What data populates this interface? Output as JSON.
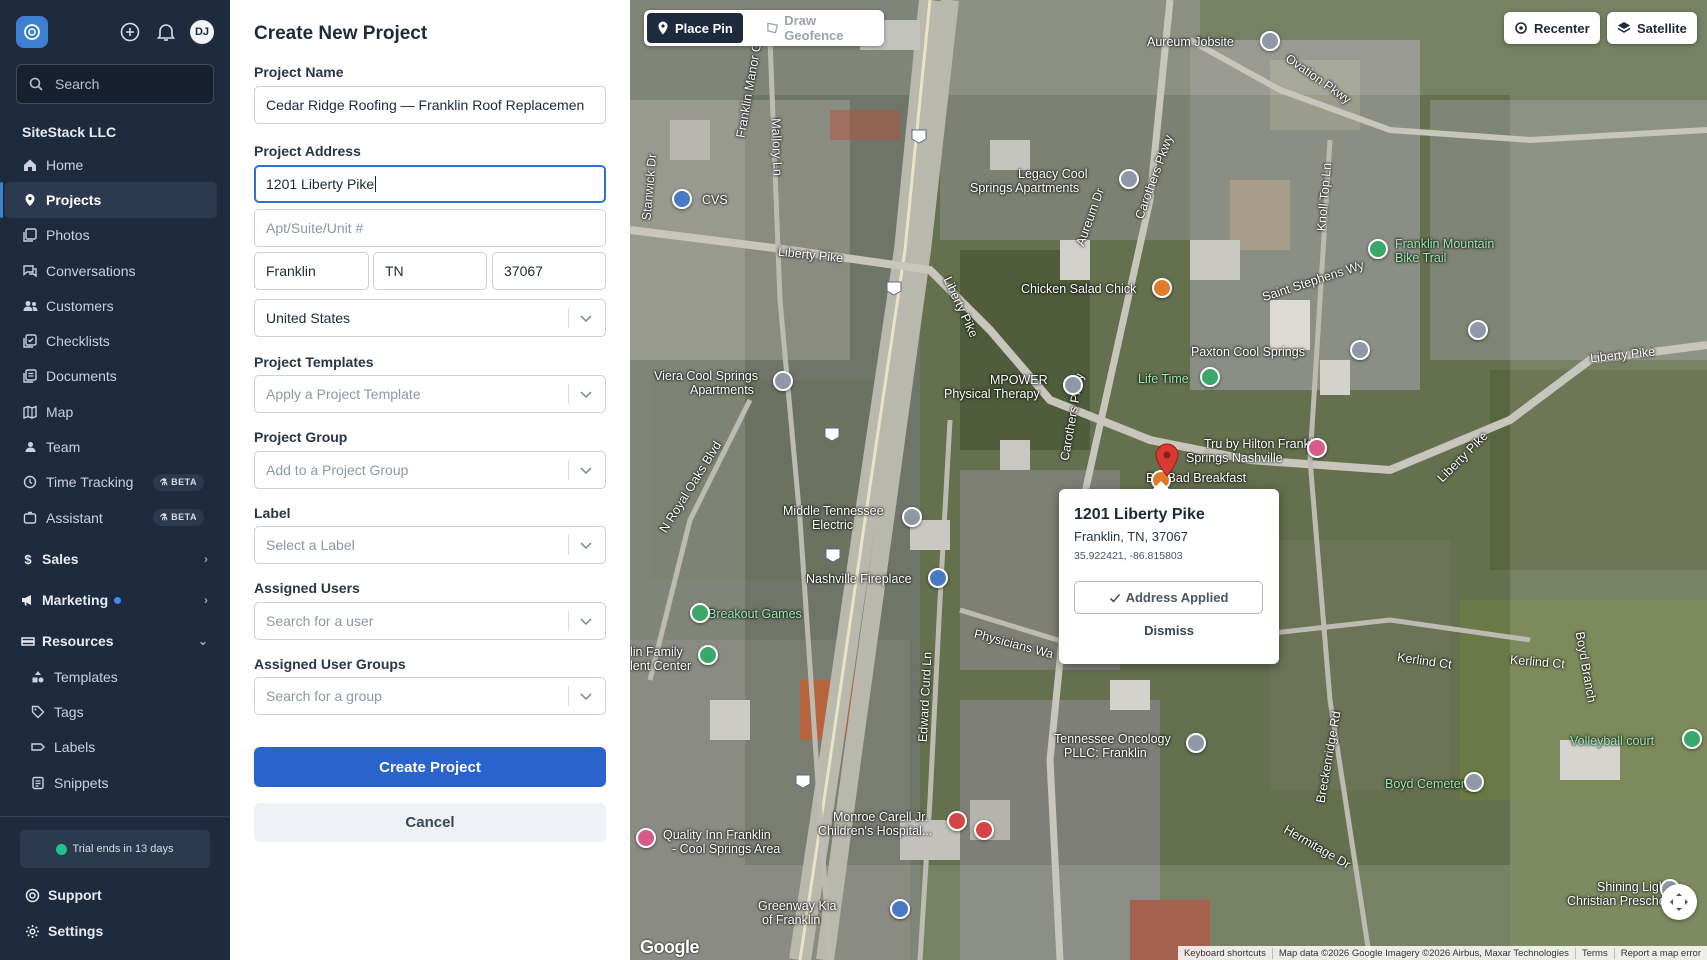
{
  "sidebar": {
    "avatar_initials": "DJ",
    "search_placeholder": "Search",
    "org_name": "SiteStack LLC",
    "nav": [
      {
        "label": "Home",
        "icon": "home-icon"
      },
      {
        "label": "Projects",
        "icon": "map-pin-icon",
        "active": true
      },
      {
        "label": "Photos",
        "icon": "photos-icon"
      },
      {
        "label": "Conversations",
        "icon": "chat-icon"
      },
      {
        "label": "Customers",
        "icon": "customers-icon"
      },
      {
        "label": "Checklists",
        "icon": "checklist-icon"
      },
      {
        "label": "Documents",
        "icon": "documents-icon"
      },
      {
        "label": "Map",
        "icon": "map-icon"
      },
      {
        "label": "Team",
        "icon": "team-icon"
      },
      {
        "label": "Time Tracking",
        "icon": "clock-icon",
        "badge": "BETA"
      },
      {
        "label": "Assistant",
        "icon": "assistant-icon",
        "badge": "BETA"
      }
    ],
    "sections": {
      "sales": "Sales",
      "marketing": "Marketing",
      "resources": "Resources"
    },
    "resources_items": [
      {
        "label": "Templates",
        "icon": "templates-icon"
      },
      {
        "label": "Tags",
        "icon": "tag-icon"
      },
      {
        "label": "Labels",
        "icon": "label-icon"
      },
      {
        "label": "Snippets",
        "icon": "snippets-icon"
      }
    ],
    "trial_text": "Trial ends in 13 days",
    "support": "Support",
    "settings": "Settings"
  },
  "form": {
    "title": "Create New Project",
    "project_name_label": "Project Name",
    "project_name_value": "Cedar Ridge Roofing — Franklin Roof Replacemen",
    "project_address_label": "Project Address",
    "address_line1_value": "1201 Liberty Pike",
    "address_line2_placeholder": "Apt/Suite/Unit #",
    "city_value": "Franklin",
    "state_value": "TN",
    "zip_value": "37067",
    "country_value": "United States",
    "templates_label": "Project Templates",
    "templates_placeholder": "Apply a Project Template",
    "group_label": "Project Group",
    "group_placeholder": "Add to a Project Group",
    "label_label": "Label",
    "label_placeholder": "Select a Label",
    "users_label": "Assigned Users",
    "users_placeholder": "Search for a user",
    "user_groups_label": "Assigned User Groups",
    "user_groups_placeholder": "Search for a group",
    "create_button": "Create Project",
    "cancel_button": "Cancel"
  },
  "map": {
    "mode_place_pin": "Place Pin",
    "mode_draw_geofence": "Draw Geofence",
    "recenter": "Recenter",
    "satellite": "Satellite",
    "popup": {
      "title": "1201 Liberty Pike",
      "subtitle": "Franklin, TN, 37067",
      "coords": "35.922421, -86.815803",
      "applied": "Address Applied",
      "dismiss": "Dismiss"
    },
    "labels": [
      "Aureum Jobsite",
      "Ovation Pkwy",
      "Legacy Cool",
      "Springs Apartments",
      "Chicken Salad Chick",
      "Saint Stephens Wy",
      "Franklin Mountain",
      "Bike Trail",
      "Paxton Cool Springs",
      "Liberty Pike",
      "Life Time",
      "MPOWER",
      "Physical Therapy",
      "Viera Cool Springs",
      "Apartments",
      "Tru by Hilton Franklin",
      "Springs Nashville",
      "Big Bad Breakfast",
      "Middle Tennessee",
      "Electric",
      "Nashville Fireplace",
      "Breakout Games",
      "Physicians Wa",
      "Kerlind Ct",
      "Tennessee Oncology",
      "PLLC: Franklin",
      "Volleyball court",
      "Boyd Cemetery",
      "Monroe Carell Jr.",
      "Children's Hospital...",
      "Quality Inn Franklin",
      "- Cool Springs Area",
      "Greenway Kia",
      "of Franklin",
      "Shining Light",
      "Christian Preschool",
      "CVS",
      "Liberty Pike",
      "Liberty Pike",
      "Carothers Pkwy",
      "Knoll Top Ln",
      "Mallory Ln",
      "Stanwick Dr",
      "N Royal Oaks Blvd",
      "Edward Curd Ln",
      "Hermitage Dr",
      "Breckenridge Rd",
      "Boyd Branch",
      "Franklin Manor Cir",
      "Aureum Dr",
      "Carothers Pkwy",
      "Liberty Pike",
      "Kerlind Ct",
      "lin Family",
      "lent Center"
    ],
    "attribution": {
      "shortcuts": "Keyboard shortcuts",
      "data": "Map data ©2026 Google Imagery ©2026 Airbus, Maxar Technologies",
      "terms": "Terms",
      "report": "Report a map error"
    },
    "google": "Google"
  },
  "colors": {
    "sidebar_bg": "#1e2b3e",
    "accent": "#2a63cc",
    "pin": "#d93a32"
  }
}
